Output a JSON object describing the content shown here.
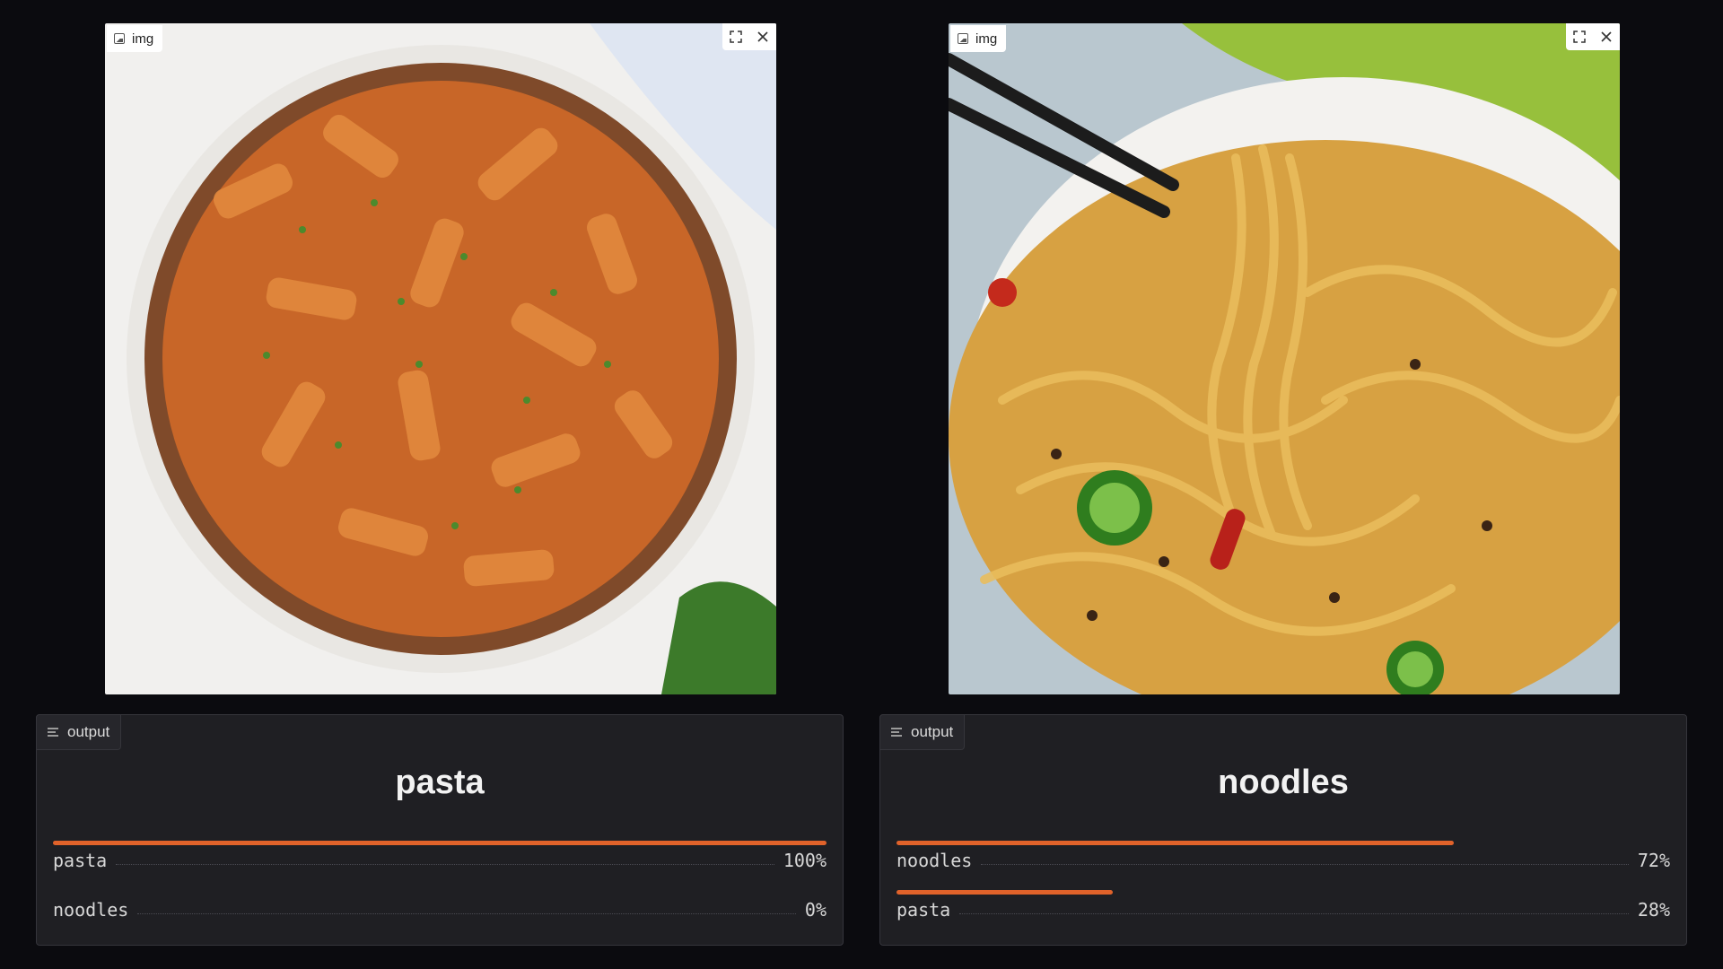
{
  "panels": [
    {
      "image": {
        "badge_label": "img",
        "alt": "pasta dish",
        "dominant": "#c96a2a"
      },
      "output": {
        "badge_label": "output",
        "title": "pasta",
        "results": [
          {
            "label": "pasta",
            "percent_text": "100%",
            "fraction": 1.0
          },
          {
            "label": "noodles",
            "percent_text": "0%",
            "fraction": 0.0
          }
        ]
      }
    },
    {
      "image": {
        "badge_label": "img",
        "alt": "noodles dish",
        "dominant": "#d39a37"
      },
      "output": {
        "badge_label": "output",
        "title": "noodles",
        "results": [
          {
            "label": "noodles",
            "percent_text": "72%",
            "fraction": 0.72
          },
          {
            "label": "pasta",
            "percent_text": "28%",
            "fraction": 0.28
          }
        ]
      }
    }
  ],
  "colors": {
    "accent": "#e0622a",
    "panel_bg": "#1f1f23",
    "page_bg": "#0b0b0f"
  },
  "icons": {
    "expand": "expand-icon",
    "close": "close-icon",
    "image": "image-icon",
    "output": "output-icon"
  }
}
